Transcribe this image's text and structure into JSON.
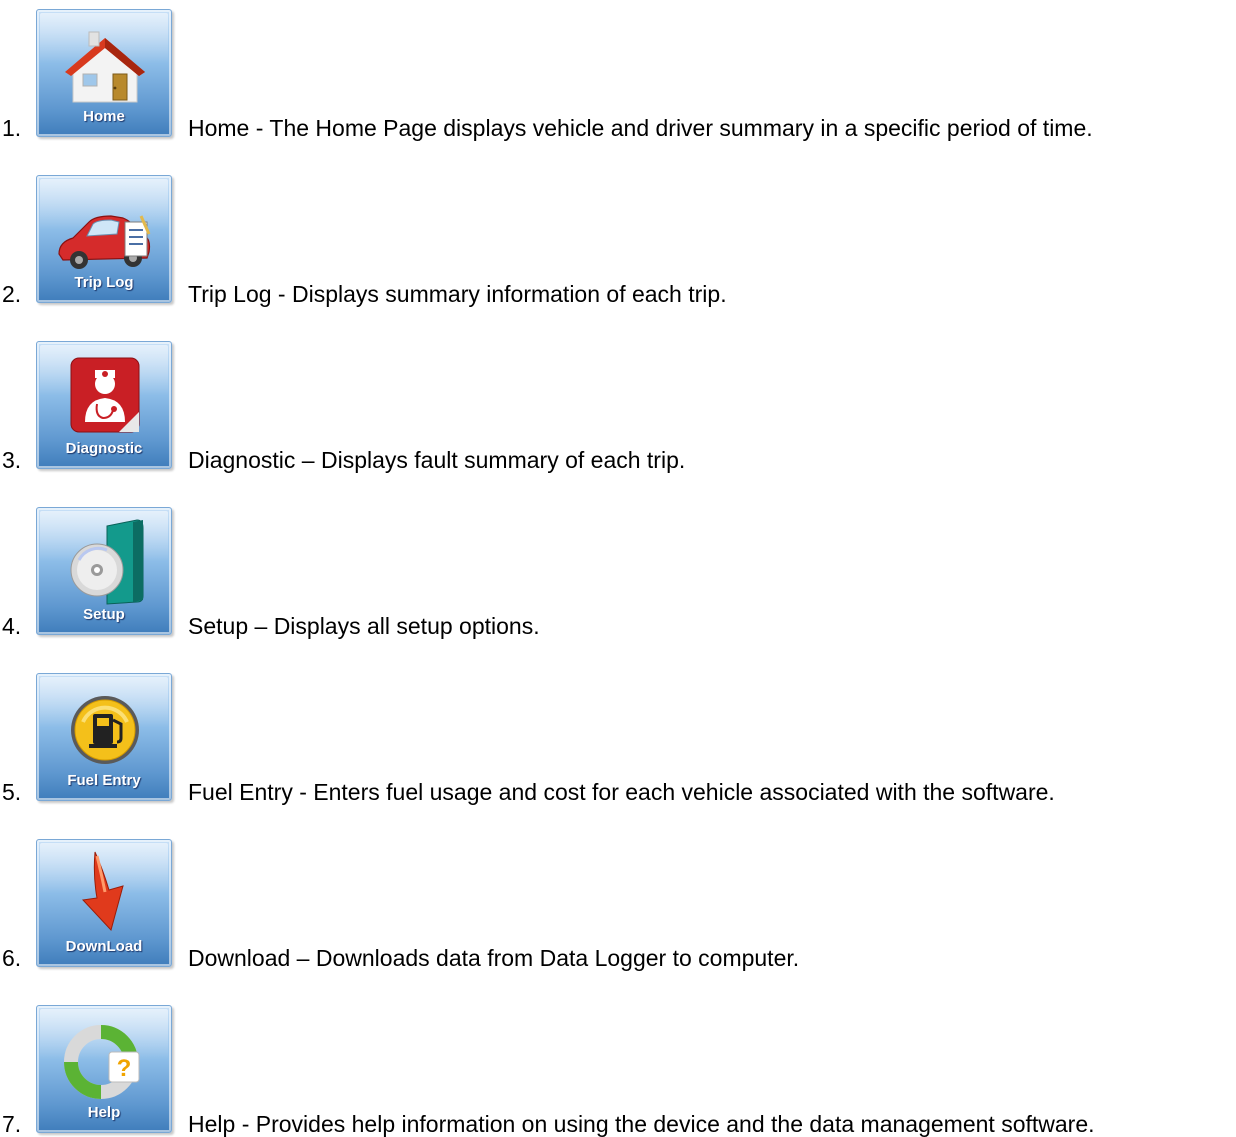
{
  "items": [
    {
      "number": "1.",
      "icon": "home-house-icon",
      "button_label": "Home",
      "term": "Home",
      "separator": " - ",
      "description": "The Home Page displays vehicle and driver summary in a specific period of time."
    },
    {
      "number": "2.",
      "icon": "car-notepad-icon",
      "button_label": "Trip Log",
      "term": "Trip Log",
      "separator": " - ",
      "description": "Displays summary information of each trip."
    },
    {
      "number": "3.",
      "icon": "doctor-icon",
      "button_label": "Diagnostic",
      "term": "Diagnostic",
      "separator": " – ",
      "description": "Displays fault summary of each trip."
    },
    {
      "number": "4.",
      "icon": "software-box-cd-icon",
      "button_label": "Setup",
      "term": "Setup",
      "separator": " – ",
      "description": "Displays all setup options."
    },
    {
      "number": "5.",
      "icon": "fuel-pump-icon",
      "button_label": "Fuel Entry",
      "term": "Fuel Entry",
      "separator": " - ",
      "description": "Enters fuel usage and cost for each vehicle associated with the software."
    },
    {
      "number": "6.",
      "icon": "download-arrow-icon",
      "button_label": "DownLoad",
      "term": "Download",
      "separator": " – ",
      "description": "Downloads data from Data Logger to computer."
    },
    {
      "number": "7.",
      "icon": "help-lifebuoy-icon",
      "button_label": "Help",
      "term": "Help",
      "separator": " - ",
      "description": "Provides help information on using the device and the data management software."
    }
  ]
}
